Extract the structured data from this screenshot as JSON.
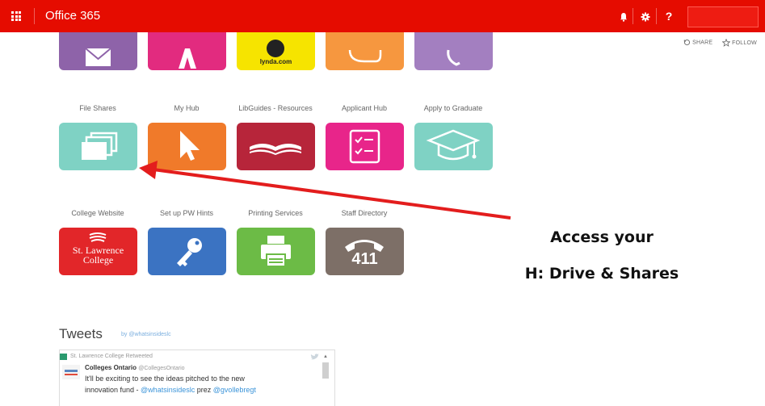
{
  "header": {
    "app_title": "Office 365",
    "help_label": "?",
    "accent_color": "#e50c00"
  },
  "subbar": {
    "share_label": "SHARE",
    "follow_label": "FOLLOW"
  },
  "tiles_row2": [
    {
      "label": "File Shares",
      "color": "#7fd2c4"
    },
    {
      "label": "My Hub",
      "color": "#f07a2a"
    },
    {
      "label": "LibGuides - Resources",
      "color": "#b7253a"
    },
    {
      "label": "Applicant Hub",
      "color": "#e8258a"
    },
    {
      "label": "Apply to Graduate",
      "color": "#7fd2c4"
    }
  ],
  "tiles_row3": [
    {
      "label": "College Website",
      "color": "#e22629",
      "logo_line1": "St. Lawrence",
      "logo_line2": "College"
    },
    {
      "label": "Set up PW Hints",
      "color": "#3b73c2"
    },
    {
      "label": "Printing Services",
      "color": "#6cbb46"
    },
    {
      "label": "Staff Directory",
      "color": "#7d6f67",
      "icon_text": "411"
    }
  ],
  "top_row_partial": {
    "lynda_label": "lynda.com"
  },
  "callout": {
    "line1": "Access your",
    "line2": "H: Drive & Shares",
    "arrow_color": "#e31d1d"
  },
  "tweets": {
    "title": "Tweets",
    "by": "by @whatsinsideslc",
    "retweeted": "St. Lawrence College Retweeted",
    "author": "Colleges Ontario",
    "author_handle": "@CollegesOntario",
    "line1": "It'll be exciting to see the ideas pitched to the new",
    "line2_a": "innovation fund - ",
    "mention1": "@whatsinsideslc",
    "line2_b": " prez ",
    "mention2": "@gvollebregt",
    "mention_color": "#3b94d9"
  }
}
